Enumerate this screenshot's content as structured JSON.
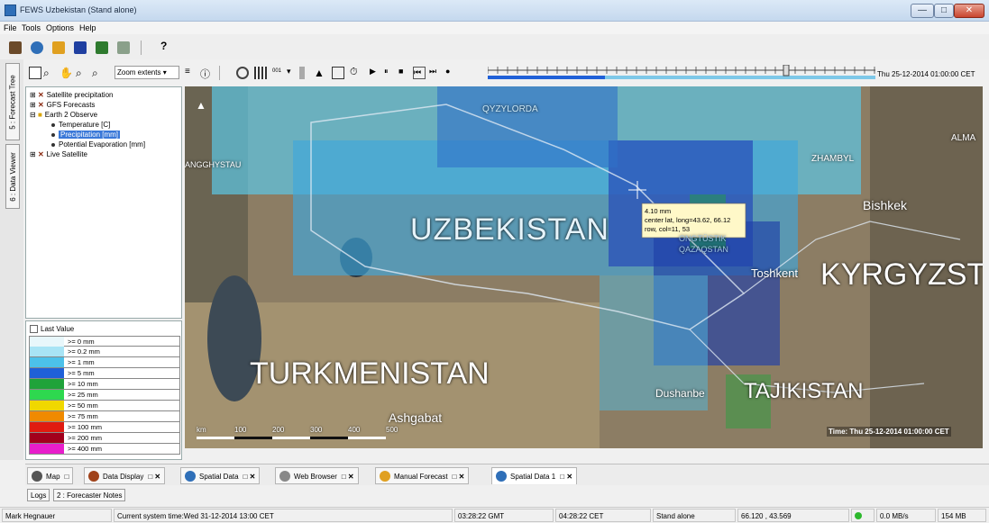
{
  "window": {
    "title": "FEWS Uzbekistan (Stand alone)",
    "minimize": "—",
    "maximize": "□",
    "close": "✕"
  },
  "menu": [
    "File",
    "Tools",
    "Options",
    "Help"
  ],
  "toolbar": {
    "help_label": "?",
    "zoom_select": "Zoom extents",
    "time_label": "Thu 25-12-2014 01:00:00 CET",
    "steps_label": "001"
  },
  "side_tabs": [
    "5 : Forecast Tree",
    "6 : Data Viewer"
  ],
  "tree": {
    "items": [
      {
        "label": "Satellite precipitation",
        "icon": "x-icon"
      },
      {
        "label": "GFS Forecasts",
        "icon": "x-icon"
      },
      {
        "label": "Earth 2 Observe",
        "icon": "folder-icon"
      },
      {
        "label": "Temperature [C]",
        "icon": "dot-icon"
      },
      {
        "label": "Precipitation [mm]",
        "icon": "dot-icon",
        "selected": true
      },
      {
        "label": "Potential Evaporation [mm]",
        "icon": "dot-icon"
      },
      {
        "label": "Live Satellite",
        "icon": "x-icon"
      }
    ]
  },
  "legend": {
    "checkbox_label": "Last Value",
    "rows": [
      {
        "label": ">= 0 mm",
        "color": "#e8f7fb"
      },
      {
        "label": ">= 0.2 mm",
        "color": "#a8e4f5"
      },
      {
        "label": ">= 1 mm",
        "color": "#4cc1ea"
      },
      {
        "label": ">= 5 mm",
        "color": "#1f60d8"
      },
      {
        "label": ">= 10 mm",
        "color": "#1fa33a"
      },
      {
        "label": ">= 25 mm",
        "color": "#2ed84f"
      },
      {
        "label": ">= 50 mm",
        "color": "#f0d800"
      },
      {
        "label": ">= 75 mm",
        "color": "#f08a00"
      },
      {
        "label": ">= 100 mm",
        "color": "#e01b10"
      },
      {
        "label": ">= 200 mm",
        "color": "#a2001c"
      },
      {
        "label": ">= 400 mm",
        "color": "#e81ecb"
      }
    ]
  },
  "map": {
    "labels": {
      "qyzylorda": "QYZYLORDA",
      "mangghystau": "ANGGHYSTAU",
      "zhambyl": "ZHAMBYL",
      "alma": "ALMA",
      "uzbekistan": "UZBEKISTAN",
      "bishkek": "Bishkek",
      "kyrgyz": "KYRGYZST",
      "toshkent": "Toshkent",
      "ongtustik": "ONGTÜSTIK",
      "qazaqstan": "QAZAQSTAN",
      "turkmenistan": "TURKMENISTAN",
      "tajikistan": "TAJIKISTAN",
      "dushanbe": "Dushanbe",
      "ashgabat": "Ashgabat"
    },
    "tooltip": {
      "value": "4.10 mm",
      "coords": "center lat, long=43.62, 66.12",
      "cell": "row, col=11, 53"
    },
    "time_overlay": "Time: Thu 25-12-2014 01:00:00 CET",
    "scale_ticks": [
      "km",
      "100",
      "200",
      "300",
      "400",
      "500"
    ]
  },
  "bottom_tabs": [
    {
      "label": "Map",
      "icon": "globe-icon",
      "buttons": "□",
      "color": "#555"
    },
    {
      "label": "Data Display",
      "icon": "data-display-icon",
      "buttons": "□ ✕",
      "color": "#a0421a"
    },
    {
      "label": "Spatial Data",
      "icon": "spatial-data-icon",
      "buttons": "□ ✕",
      "color": "#2f6fb8"
    },
    {
      "label": "Web Browser",
      "icon": "web-browser-icon",
      "buttons": "□ ✕",
      "color": "#888"
    },
    {
      "label": "Manual Forecast",
      "icon": "manual-forecast-icon",
      "buttons": "□ ✕",
      "color": "#e0a020"
    },
    {
      "label": "Spatial Data 1",
      "icon": "spatial-data-icon",
      "buttons": "□ ✕",
      "color": "#2f6fb8",
      "active": true
    }
  ],
  "log_buttons": [
    "Logs",
    "2 : Forecaster Notes"
  ],
  "status": {
    "user": "Mark Hegnauer",
    "system_time": "Current system time:Wed 31-12-2014 13:00 CET",
    "gmt": "03:28:22 GMT",
    "cet": "04:28:22 CET",
    "mode": "Stand alone",
    "coords": "66.120 , 43.569",
    "rate": "0.0 MB/s",
    "memory": "154 MB",
    "indicator_color": "#2db82d"
  }
}
